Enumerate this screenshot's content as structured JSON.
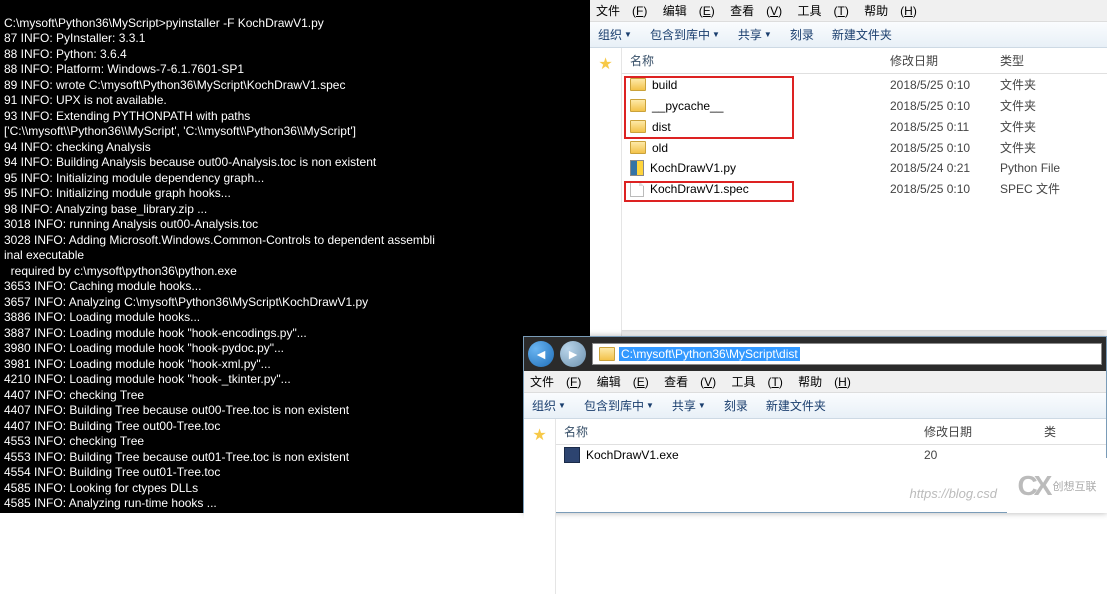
{
  "terminal": {
    "prompt": "C:\\mysoft\\Python36\\MyScript>pyinstaller -F KochDrawV1.py",
    "lines": [
      "87 INFO: PyInstaller: 3.3.1",
      "88 INFO: Python: 3.6.4",
      "88 INFO: Platform: Windows-7-6.1.7601-SP1",
      "89 INFO: wrote C:\\mysoft\\Python36\\MyScript\\KochDrawV1.spec",
      "91 INFO: UPX is not available.",
      "93 INFO: Extending PYTHONPATH with paths",
      "['C:\\\\mysoft\\\\Python36\\\\MyScript', 'C:\\\\mysoft\\\\Python36\\\\MyScript']",
      "94 INFO: checking Analysis",
      "94 INFO: Building Analysis because out00-Analysis.toc is non existent",
      "95 INFO: Initializing module dependency graph...",
      "95 INFO: Initializing module graph hooks...",
      "98 INFO: Analyzing base_library.zip ...",
      "3018 INFO: running Analysis out00-Analysis.toc",
      "3028 INFO: Adding Microsoft.Windows.Common-Controls to dependent assembli",
      "inal executable",
      "  required by c:\\mysoft\\python36\\python.exe",
      "3653 INFO: Caching module hooks...",
      "3657 INFO: Analyzing C:\\mysoft\\Python36\\MyScript\\KochDrawV1.py",
      "3886 INFO: Loading module hooks...",
      "3887 INFO: Loading module hook \"hook-encodings.py\"...",
      "3980 INFO: Loading module hook \"hook-pydoc.py\"...",
      "3981 INFO: Loading module hook \"hook-xml.py\"...",
      "4210 INFO: Loading module hook \"hook-_tkinter.py\"...",
      "4407 INFO: checking Tree",
      "4407 INFO: Building Tree because out00-Tree.toc is non existent",
      "4407 INFO: Building Tree out00-Tree.toc",
      "4553 INFO: checking Tree",
      "4553 INFO: Building Tree because out01-Tree.toc is non existent",
      "4554 INFO: Building Tree out01-Tree.toc",
      "4585 INFO: Looking for ctypes DLLs",
      "4585 INFO: Analyzing run-time hooks ..."
    ]
  },
  "menus": {
    "file_zh": "文件",
    "file_k": "F",
    "edit_zh": "编辑",
    "edit_k": "E",
    "view_zh": "查看",
    "view_k": "V",
    "tools_zh": "工具",
    "tools_k": "T",
    "help_zh": "帮助",
    "help_k": "H"
  },
  "toolbar": {
    "organize": "组织",
    "include": "包含到库中",
    "share": "共享",
    "burn": "刻录",
    "newfolder": "新建文件夹"
  },
  "columns": {
    "name": "名称",
    "date": "修改日期",
    "type": "类型"
  },
  "explorer_top": {
    "files": [
      {
        "name": "build",
        "date": "2018/5/25 0:10",
        "type": "文件夹",
        "icon": "folder",
        "boxed": true
      },
      {
        "name": "__pycache__",
        "date": "2018/5/25 0:10",
        "type": "文件夹",
        "icon": "folder",
        "boxed": true
      },
      {
        "name": "dist",
        "date": "2018/5/25 0:11",
        "type": "文件夹",
        "icon": "folder",
        "boxed": true
      },
      {
        "name": "old",
        "date": "2018/5/25 0:10",
        "type": "文件夹",
        "icon": "folder",
        "boxed": false
      },
      {
        "name": "KochDrawV1.py",
        "date": "2018/5/24 0:21",
        "type": "Python File",
        "icon": "py",
        "boxed": false
      },
      {
        "name": "KochDrawV1.spec",
        "date": "2018/5/25 0:10",
        "type": "SPEC 文件",
        "icon": "file",
        "boxed": false
      }
    ]
  },
  "explorer_bottom": {
    "path": "C:\\mysoft\\Python36\\MyScript\\dist",
    "files": [
      {
        "name": "KochDrawV1.exe",
        "date": "20",
        "type": "",
        "icon": "exe"
      }
    ]
  },
  "watermark": "https://blog.csd",
  "logo_text": "创想互联"
}
